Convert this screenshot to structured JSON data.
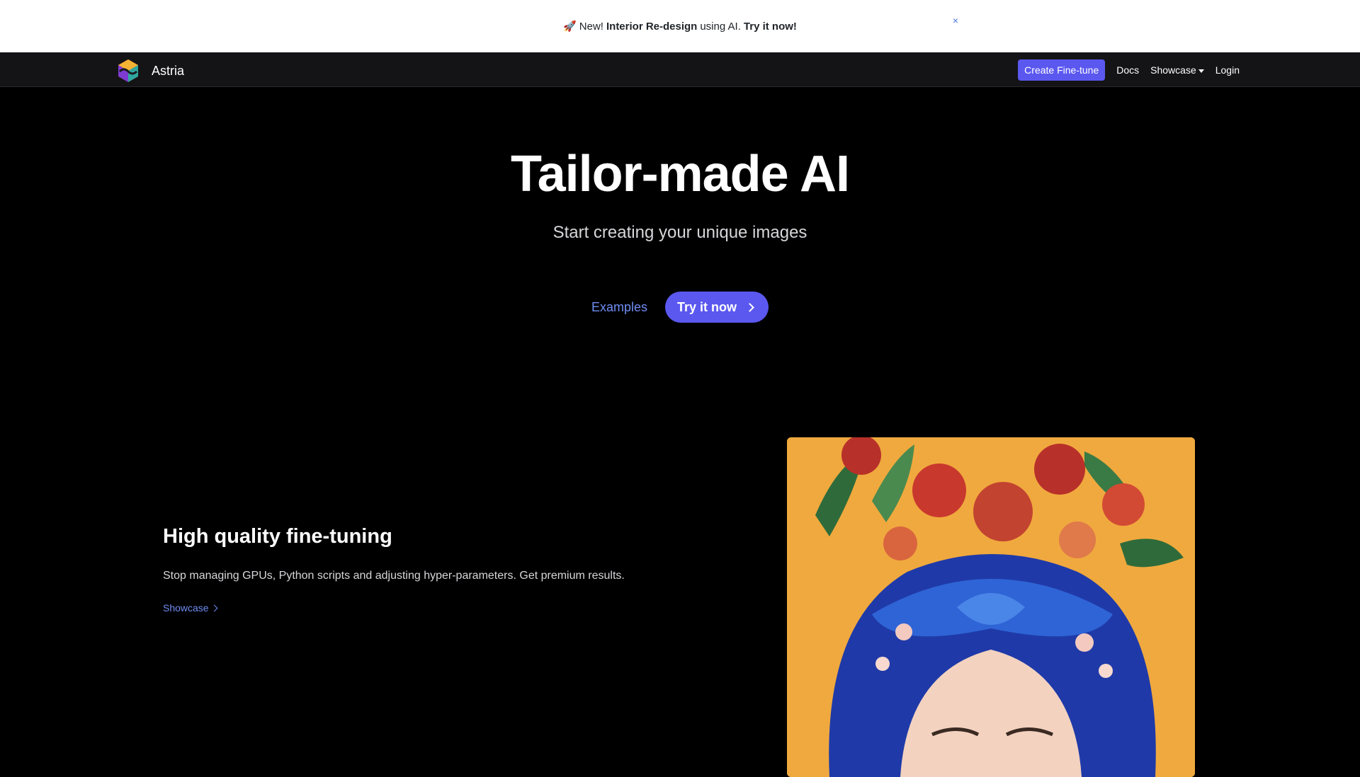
{
  "banner": {
    "emoji": "🚀",
    "new": "New!",
    "highlight": "Interior Re-design",
    "middle": "using AI.",
    "cta": "Try it now!",
    "close": "×"
  },
  "nav": {
    "brand": "Astria",
    "create_button": "Create Fine-tune",
    "docs": "Docs",
    "showcase": "Showcase",
    "login": "Login"
  },
  "hero": {
    "title": "Tailor-made AI",
    "subtitle": "Start creating your unique images",
    "examples": "Examples",
    "try_now": "Try it now"
  },
  "feature": {
    "title": "High quality fine-tuning",
    "description": "Stop managing GPUs, Python scripts and adjusting hyper-parameters. Get premium results.",
    "link": "Showcase"
  },
  "colors": {
    "accent": "#5b58f0",
    "link": "#6f8cf3",
    "art_background": "#f0a93e"
  }
}
